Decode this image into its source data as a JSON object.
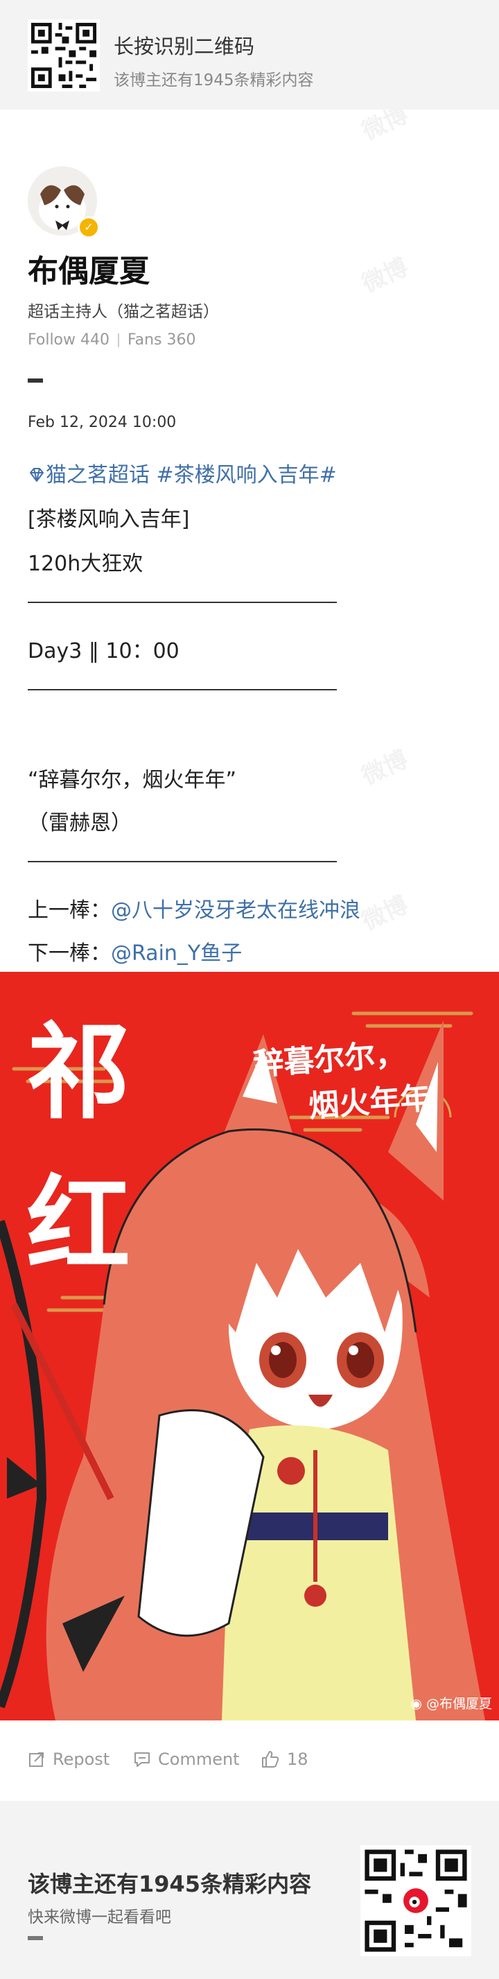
{
  "banner_top": {
    "title": "长按识别二维码",
    "subtitle": "该博主还有1945条精彩内容"
  },
  "profile": {
    "name": "布偶厦夏",
    "role": "超话主持人（猫之茗超话）",
    "follow": "Follow 440",
    "fans": "Fans 360"
  },
  "post": {
    "date": "Feb 12, 2024 10:00",
    "topic1": "猫之茗超话",
    "topic2": "#茶楼风响入吉年#",
    "line_bracket": "[茶楼风响入吉年]",
    "line_event": "120h大狂欢",
    "line_day": "Day3 ‖ 10：00",
    "line_quote": "“辞暮尔尔，烟火年年”",
    "line_name": "（雷赫恩）",
    "prev_label": "上一棒：",
    "prev_user": "@八十岁没牙老太在线冲浪",
    "next_label": "下一棒：",
    "next_user": "@Rain_Y鱼子"
  },
  "image": {
    "big_text_1": "祁",
    "big_text_2": "红",
    "poem_line_1": "辞暮尔尔，",
    "poem_line_2": "烟火年年",
    "watermark": "@布偶厦夏",
    "colors": {
      "background": "#e8261e",
      "hair": "#e8735a",
      "dress": "#f2f0a0"
    }
  },
  "actions": {
    "repost": "Repost",
    "comment": "Comment",
    "likes": "18"
  },
  "banner_bottom": {
    "title": "该博主还有1945条精彩内容",
    "subtitle": "快来微博一起看看吧"
  },
  "watermark_text": "微博"
}
